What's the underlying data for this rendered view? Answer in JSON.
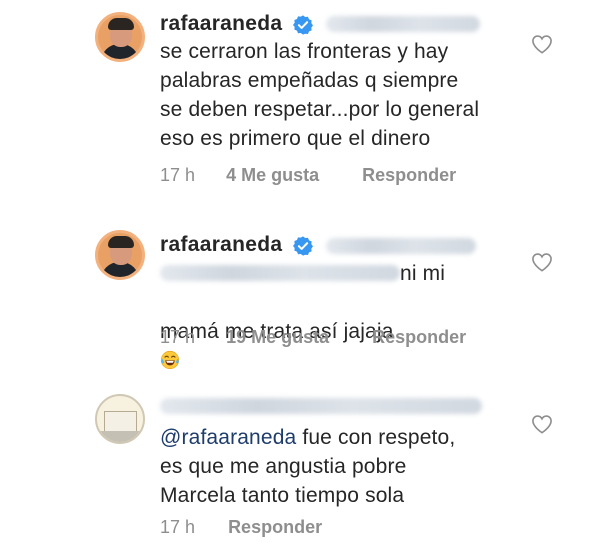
{
  "comments": [
    {
      "username": "rafaaraneda",
      "text": "se cerraron las fronteras y hay\npalabras empeñadas q siempre\nse deben respetar...por lo general\neso es primero que el dinero",
      "time": "17 h",
      "likes": "4 Me gusta",
      "reply": "Responder"
    },
    {
      "username": "rafaaraneda",
      "text_line1": "ni mi",
      "text_line2": "mamá me trata así jajaja",
      "emoji": "tears-of-joy-emoji",
      "time": "17 h",
      "likes": "19 Me gusta",
      "reply": "Responder"
    },
    {
      "mention": "@rafaaraneda",
      "text_after_mention": " fue con respeto,",
      "text_rest": "es que me angustia pobre\nMarcela tanto tiempo sola",
      "time": "17 h",
      "reply": "Responder"
    }
  ],
  "icons": {
    "verified": "verified-badge-icon",
    "like": "heart-outline-icon"
  },
  "colors": {
    "verified_blue": "#3897f0",
    "text": "#262626",
    "meta_gray": "#8e8e8e",
    "mention": "#1e3d6b"
  }
}
